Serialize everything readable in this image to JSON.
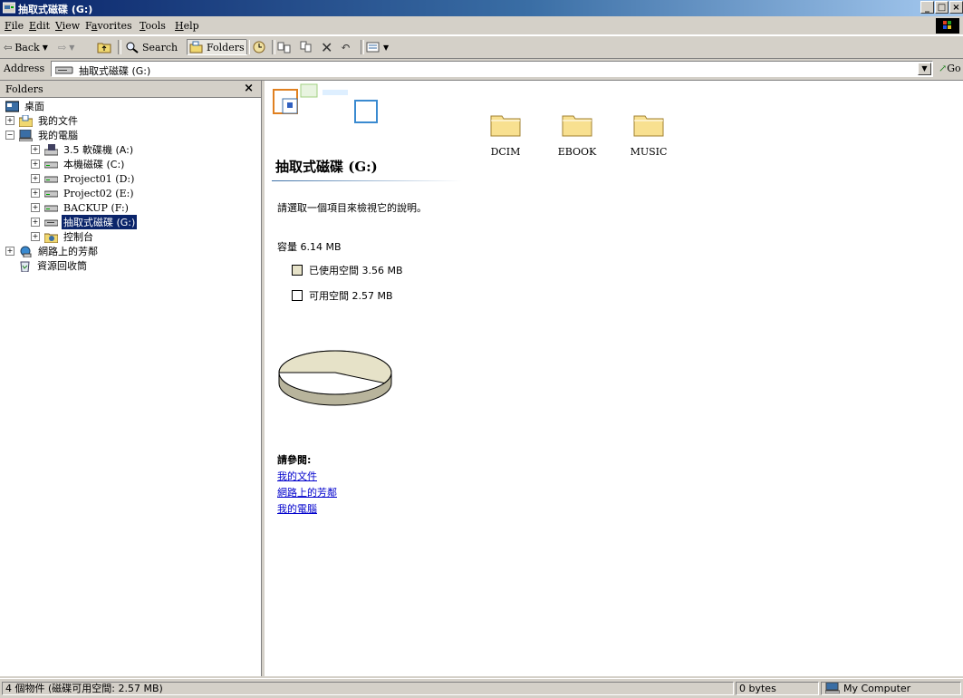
{
  "window": {
    "title": "抽取式磁碟 (G:)",
    "buttons": {
      "minimize": "_",
      "maximize": "□",
      "close": "×"
    }
  },
  "menu": [
    {
      "label": "File",
      "accel": "F",
      "rest": "ile"
    },
    {
      "label": "Edit",
      "accel": "E",
      "rest": "dit"
    },
    {
      "label": "View",
      "accel": "V",
      "rest": "iew"
    },
    {
      "label": "Favorites",
      "accel": "a",
      "pre": "F",
      "rest": "vorites"
    },
    {
      "label": "Tools",
      "accel": "T",
      "rest": "ools"
    },
    {
      "label": "Help",
      "accel": "H",
      "rest": "elp"
    }
  ],
  "toolbar": {
    "back": "Back",
    "search": "Search",
    "folders": "Folders"
  },
  "address": {
    "label": "Address",
    "value": "抽取式磁碟 (G:)",
    "go": "Go"
  },
  "folders_pane": {
    "title": "Folders",
    "close": "×",
    "tree": [
      {
        "label": "桌面",
        "expander": "",
        "icon": "desktop-icon"
      },
      {
        "label": "我的文件",
        "expander": "+",
        "icon": "my-documents-icon"
      },
      {
        "label": "我的電腦",
        "expander": "−",
        "icon": "my-computer-icon"
      },
      {
        "label": "3.5 軟碟機 (A:)",
        "expander": "+",
        "icon": "floppy-drive-icon"
      },
      {
        "label": "本機磁碟 (C:)",
        "expander": "+",
        "icon": "hard-drive-icon"
      },
      {
        "label": "Project01 (D:)",
        "expander": "+",
        "icon": "hard-drive-icon"
      },
      {
        "label": "Project02 (E:)",
        "expander": "+",
        "icon": "hard-drive-icon"
      },
      {
        "label": "BACKUP (F:)",
        "expander": "+",
        "icon": "hard-drive-icon"
      },
      {
        "label": "抽取式磁碟 (G:)",
        "expander": "+",
        "icon": "removable-drive-icon",
        "selected": true
      },
      {
        "label": "控制台",
        "expander": "+",
        "icon": "control-panel-icon"
      },
      {
        "label": "網路上的芳鄰",
        "expander": "+",
        "icon": "network-places-icon"
      },
      {
        "label": "資源回收筒",
        "expander": "",
        "icon": "recycle-bin-icon"
      }
    ]
  },
  "info_panel": {
    "drive_title": "抽取式磁碟 (G:)",
    "description": "請選取一個項目來檢視它的說明。",
    "capacity": "容量 6.14 MB",
    "used": "已使用空間 3.56 MB",
    "free": "可用空間 2.57 MB",
    "used_fraction": 0.58,
    "colors": {
      "used": "#3a3ab0",
      "free": "#e6e2c8",
      "shade": "#b8b49c"
    },
    "see_also": "請參閱:",
    "links": [
      "我的文件",
      "網路上的芳鄰",
      "我的電腦"
    ]
  },
  "folders": [
    "DCIM",
    "EBOOK",
    "MUSIC"
  ],
  "status": {
    "objects": "4 個物件 (磁碟可用空間: 2.57 MB)",
    "size": "0 bytes",
    "zone": "My Computer"
  }
}
